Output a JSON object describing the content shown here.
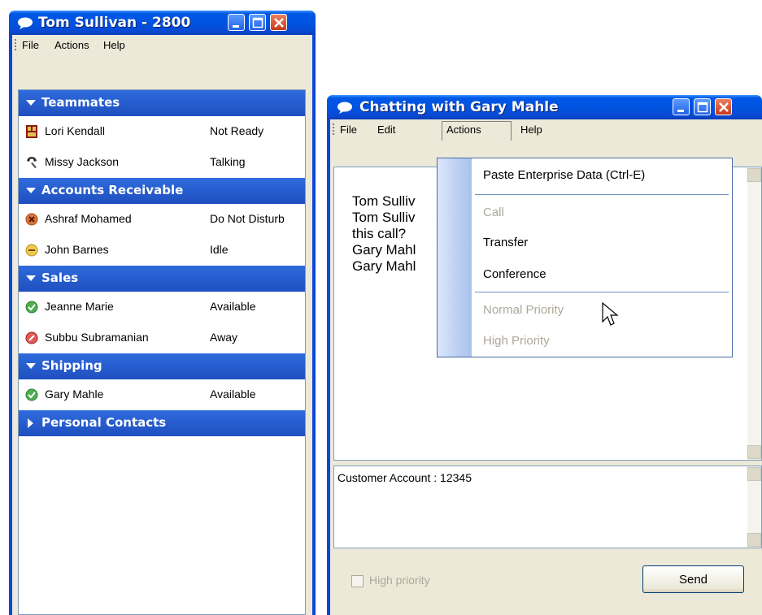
{
  "contacts_window": {
    "title": "Tom Sullivan - 2800",
    "menu": [
      "File",
      "Actions",
      "Help"
    ],
    "groups": [
      {
        "name": "Teammates",
        "expanded": true,
        "contacts": [
          {
            "name": "Lori Kendall",
            "status": "Not Ready",
            "icon": "not-ready-icon"
          },
          {
            "name": "Missy Jackson",
            "status": "Talking",
            "icon": "phone-handset-icon"
          }
        ]
      },
      {
        "name": "Accounts Receivable",
        "expanded": true,
        "contacts": [
          {
            "name": "Ashraf Mohamed",
            "status": "Do Not Disturb",
            "icon": "do-not-disturb-icon"
          },
          {
            "name": "John Barnes",
            "status": "Idle",
            "icon": "idle-icon"
          }
        ]
      },
      {
        "name": "Sales",
        "expanded": true,
        "contacts": [
          {
            "name": "Jeanne Marie",
            "status": "Available",
            "icon": "available-icon"
          },
          {
            "name": "Subbu Subramanian",
            "status": "Away",
            "icon": "away-icon"
          }
        ]
      },
      {
        "name": "Shipping",
        "expanded": true,
        "contacts": [
          {
            "name": "Gary Mahle",
            "status": "Available",
            "icon": "available-icon"
          }
        ]
      },
      {
        "name": "Personal Contacts",
        "expanded": false,
        "contacts": []
      }
    ]
  },
  "chat_window": {
    "title": "Chatting with Gary Mahle",
    "menu": [
      "File",
      "Edit",
      "Actions",
      "Help"
    ],
    "transcript_lines": [
      "Tom Sulliv",
      "Tom Sulliv",
      "this call?",
      "Gary Mahl",
      "Gary Mahl"
    ],
    "input_text": "Customer Account : 12345",
    "high_priority_label": "High priority",
    "send_label": "Send"
  },
  "actions_menu": [
    {
      "label": "Paste Enterprise Data (Ctrl-E)",
      "enabled": true
    },
    {
      "label": "Call",
      "enabled": false
    },
    {
      "label": "Transfer",
      "enabled": true
    },
    {
      "label": "Conference",
      "enabled": true
    },
    {
      "label": "Normal Priority",
      "enabled": false
    },
    {
      "label": "High Priority",
      "enabled": false
    }
  ],
  "colors": {
    "titlebar": "#0058e6",
    "group_header": "#2f6bdc",
    "chrome": "#ece9d8"
  }
}
